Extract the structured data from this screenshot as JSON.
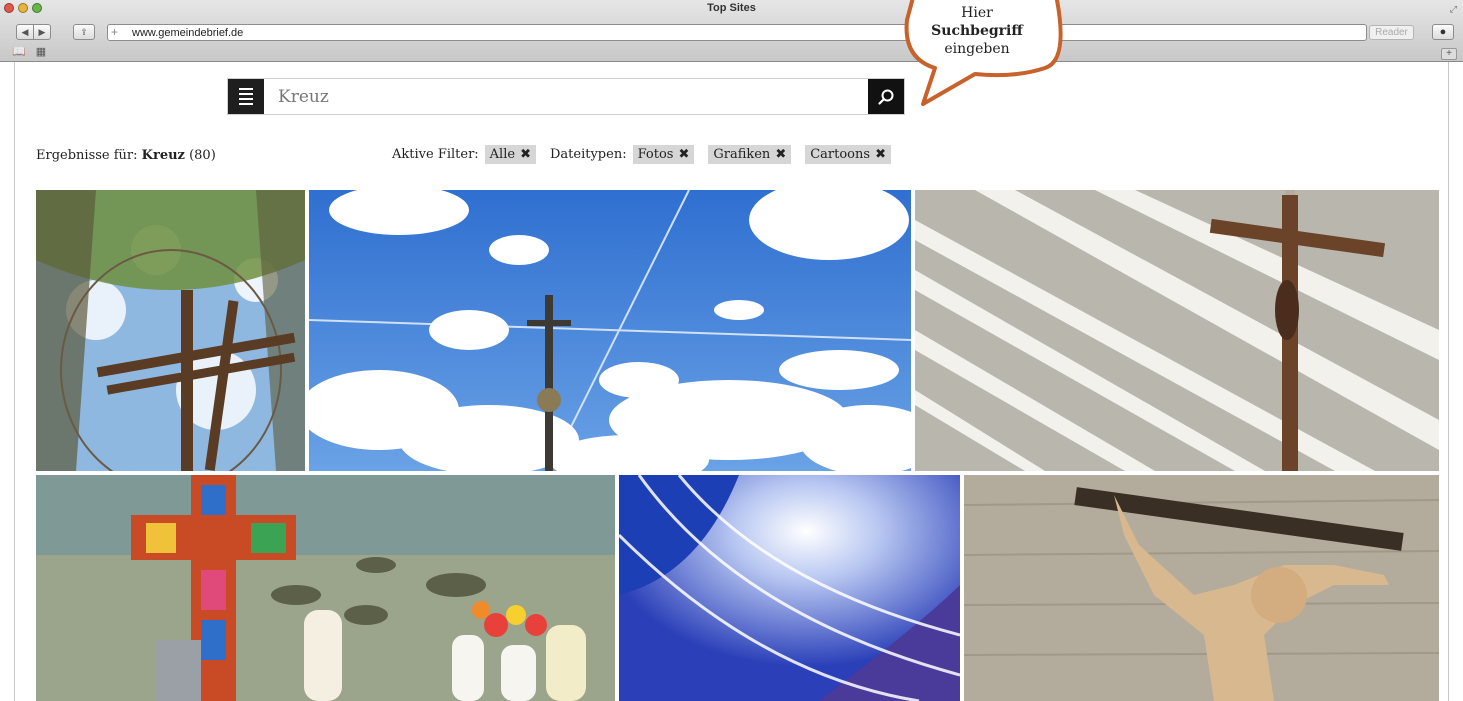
{
  "browser": {
    "window_title": "Top Sites",
    "url": "www.gemeindebrief.de",
    "reader_label": "Reader"
  },
  "search": {
    "value": "Kreuz"
  },
  "callout": {
    "line1": "Hier",
    "line2": "Suchbegriff",
    "line3": "eingeben",
    "border_color": "#c8612a"
  },
  "results": {
    "prefix": "Ergebnisse für:",
    "term": "Kreuz",
    "count": "(80)"
  },
  "filters": {
    "active_label": "Aktive Filter:",
    "active_chips": [
      {
        "label": "Alle"
      }
    ],
    "filetype_label": "Dateitypen:",
    "filetype_chips": [
      {
        "label": "Fotos"
      },
      {
        "label": "Grafiken"
      },
      {
        "label": "Cartoons"
      }
    ]
  },
  "images": [
    {
      "subject": "wooden cross under tree canopy"
    },
    {
      "subject": "summit cross against blue sky"
    },
    {
      "subject": "wooden crucifix on white wall"
    },
    {
      "subject": "colorful cross with candles by lake"
    },
    {
      "subject": "blue abstract light graphic"
    },
    {
      "subject": "carved crucifix figure on stone wall"
    }
  ]
}
